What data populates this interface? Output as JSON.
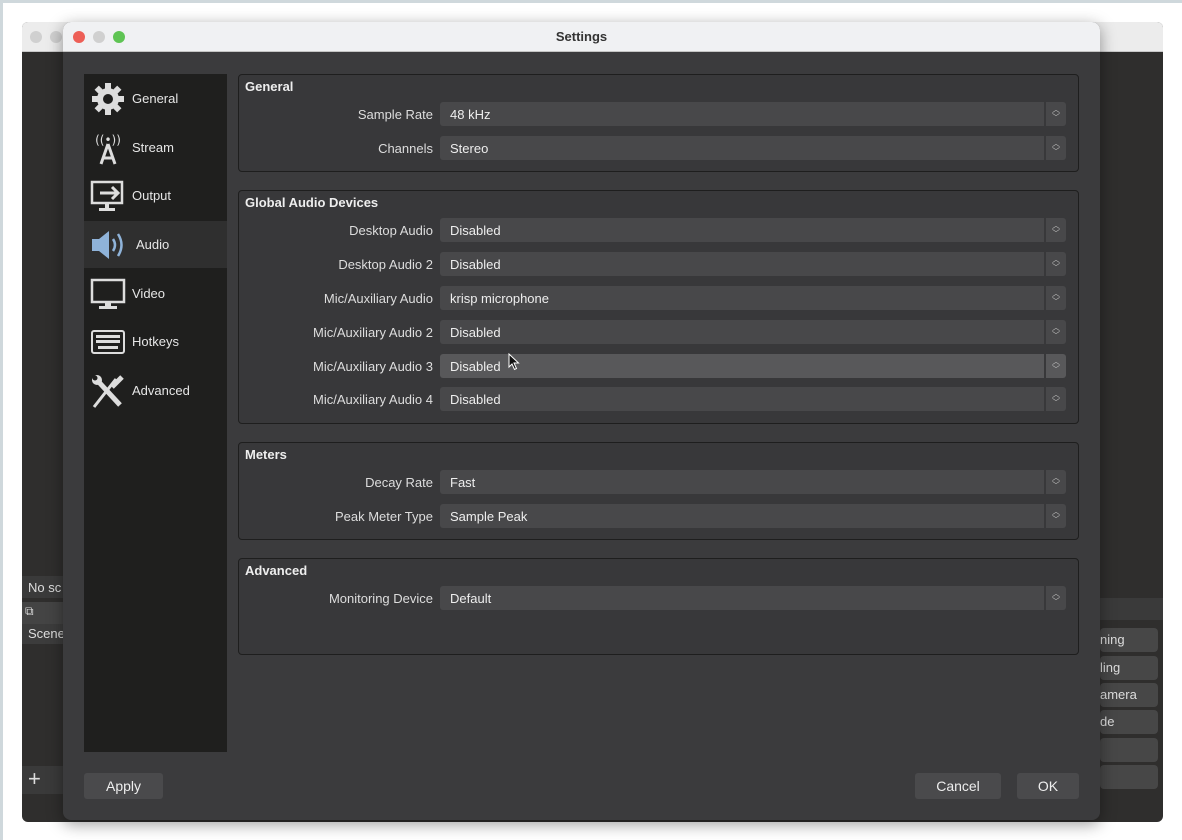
{
  "window_title": "Settings",
  "background_window": {
    "scene_status": "No sc",
    "scenes_label": "Scene",
    "add_label": "+",
    "right_buttons": [
      "ning",
      "ling",
      "amera",
      "de",
      "",
      ""
    ]
  },
  "sidebar": {
    "selected": "Audio",
    "items": [
      {
        "label": "General",
        "icon": "gear-icon"
      },
      {
        "label": "Stream",
        "icon": "antenna-icon"
      },
      {
        "label": "Output",
        "icon": "output-icon"
      },
      {
        "label": "Audio",
        "icon": "speaker-icon"
      },
      {
        "label": "Video",
        "icon": "monitor-icon"
      },
      {
        "label": "Hotkeys",
        "icon": "keyboard-icon"
      },
      {
        "label": "Advanced",
        "icon": "tools-icon"
      }
    ]
  },
  "groups": [
    {
      "title": "General",
      "rows": [
        {
          "label": "Sample Rate",
          "value": "48 kHz"
        },
        {
          "label": "Channels",
          "value": "Stereo"
        }
      ]
    },
    {
      "title": "Global Audio Devices",
      "rows": [
        {
          "label": "Desktop Audio",
          "value": "Disabled"
        },
        {
          "label": "Desktop Audio 2",
          "value": "Disabled"
        },
        {
          "label": "Mic/Auxiliary Audio",
          "value": "krisp microphone"
        },
        {
          "label": "Mic/Auxiliary Audio 2",
          "value": "Disabled"
        },
        {
          "label": "Mic/Auxiliary Audio 3",
          "value": "Disabled"
        },
        {
          "label": "Mic/Auxiliary Audio 4",
          "value": "Disabled"
        }
      ]
    },
    {
      "title": "Meters",
      "rows": [
        {
          "label": "Decay Rate",
          "value": "Fast"
        },
        {
          "label": "Peak Meter Type",
          "value": "Sample Peak"
        }
      ]
    },
    {
      "title": "Advanced",
      "rows": [
        {
          "label": "Monitoring Device",
          "value": "Default"
        }
      ]
    }
  ],
  "buttons": {
    "apply": "Apply",
    "cancel": "Cancel",
    "ok": "OK"
  },
  "colors": {
    "close": "#ed5f57",
    "minimize": "#d0d0d0",
    "zoom": "#5fc454",
    "audio_icon": "#8fb3d9"
  }
}
